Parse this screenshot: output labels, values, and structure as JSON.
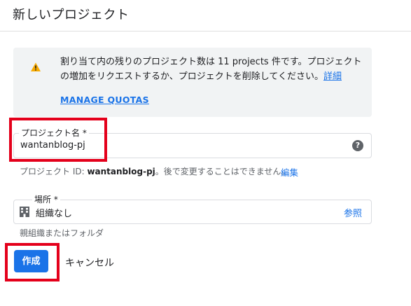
{
  "header": {
    "title": "新しいプロジェクト"
  },
  "warning": {
    "icon": "warning-icon",
    "message": "割り当て内の残りのプロジェクト数は 11 projects 件です。プロジェクトの増加をリクエストするか、プロジェクトを削除してください。",
    "detail_link": "詳細",
    "manage_link": "MANAGE QUOTAS"
  },
  "project_name": {
    "label": "プロジェクト名 *",
    "value": "wantanblog-pj",
    "help_icon": "help-icon",
    "help_glyph": "?"
  },
  "project_id": {
    "prefix": "プロジェクト ID: ",
    "id": "wantanblog-pj",
    "suffix": "。後で変更することはできません。",
    "edit_link": "編集"
  },
  "location": {
    "label": "場所 *",
    "value": "組織なし",
    "icon": "building-icon",
    "browse_link": "参照",
    "hint": "親組織またはフォルダ"
  },
  "actions": {
    "create_label": "作成",
    "cancel_label": "キャンセル"
  },
  "colors": {
    "accent": "#1a73e8",
    "warning": "#f9ab00",
    "highlight": "#e4001b"
  }
}
